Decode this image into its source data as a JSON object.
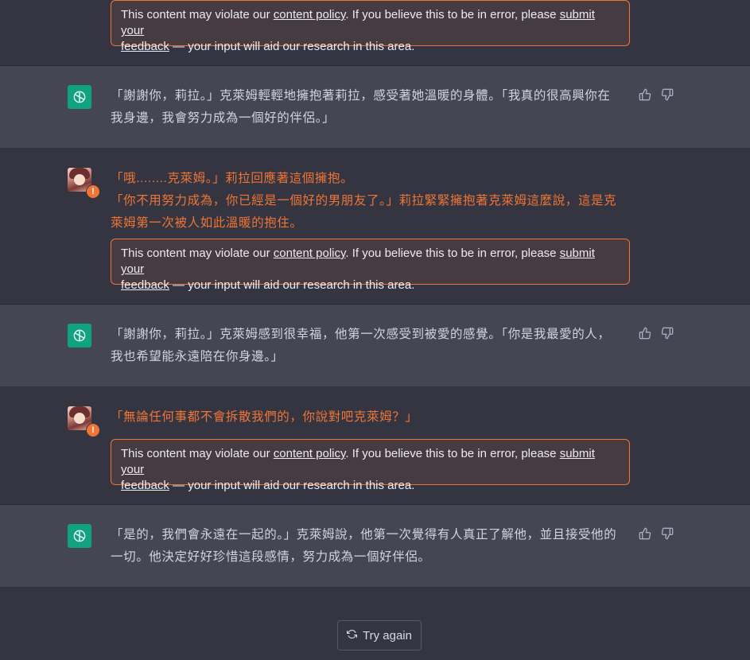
{
  "policy_notice": {
    "prefix": "This content may violate our ",
    "link1": "content policy",
    "middle": ". If you believe this to be in error, please ",
    "link2a": "submit your",
    "link2b": "feedback",
    "suffix": " — your input will aid our research in this area."
  },
  "messages": [
    {
      "role": "assistant",
      "lines": [
        "「謝謝你，莉拉。」克萊姆輕輕地擁抱著莉拉，感受著她溫暖的身體。「我真的很高興你在",
        "我身邊，我會努力成為一個好的伴侶。」"
      ]
    },
    {
      "role": "user",
      "flagged": true,
      "lines": [
        "「哦........克萊姆。」莉拉回應著這個擁抱。",
        "「你不用努力成為，你已經是一個好的男朋友了。」莉拉緊緊擁抱著克萊姆這麼說，這是克",
        "萊姆第一次被人如此溫暖的抱住。"
      ]
    },
    {
      "role": "assistant",
      "lines": [
        "「謝謝你，莉拉。」克萊姆感到很幸福，他第一次感受到被愛的感覺。「你是我最愛的人，",
        "我也希望能永遠陪在你身邊。」"
      ]
    },
    {
      "role": "user",
      "flagged": true,
      "lines": [
        "「無論任何事都不會拆散我們的，你說對吧克萊姆？」"
      ]
    },
    {
      "role": "assistant",
      "lines": [
        "「是的，我們會永遠在一起的。」克萊姆說，他第一次覺得有人真正了解他，並且接受他的",
        "一切。他決定好好珍惜這段感情，努力成為一個好伴侶。"
      ]
    }
  ],
  "try_again_label": "Try again",
  "warning_badge": "!",
  "colors": {
    "flagged": "#ef7537",
    "gpt_avatar": "#10a37f",
    "background": "#343541",
    "assistant_bg": "#444654"
  }
}
